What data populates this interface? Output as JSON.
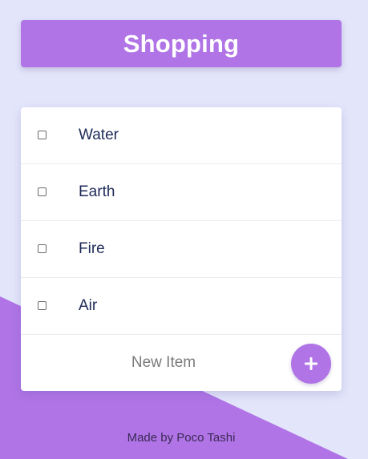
{
  "header": {
    "title": "Shopping"
  },
  "list": {
    "items": [
      {
        "label": "Water",
        "checked": false
      },
      {
        "label": "Earth",
        "checked": false
      },
      {
        "label": "Fire",
        "checked": false
      },
      {
        "label": "Air",
        "checked": false
      }
    ]
  },
  "new_item": {
    "placeholder": "New Item",
    "add_icon": "plus-icon"
  },
  "footer": {
    "credit": "Made by Poco Tashi"
  },
  "colors": {
    "background": "#e3e6fb",
    "accent": "#b074e6",
    "card": "#ffffff",
    "item_text": "#1d2a57"
  }
}
